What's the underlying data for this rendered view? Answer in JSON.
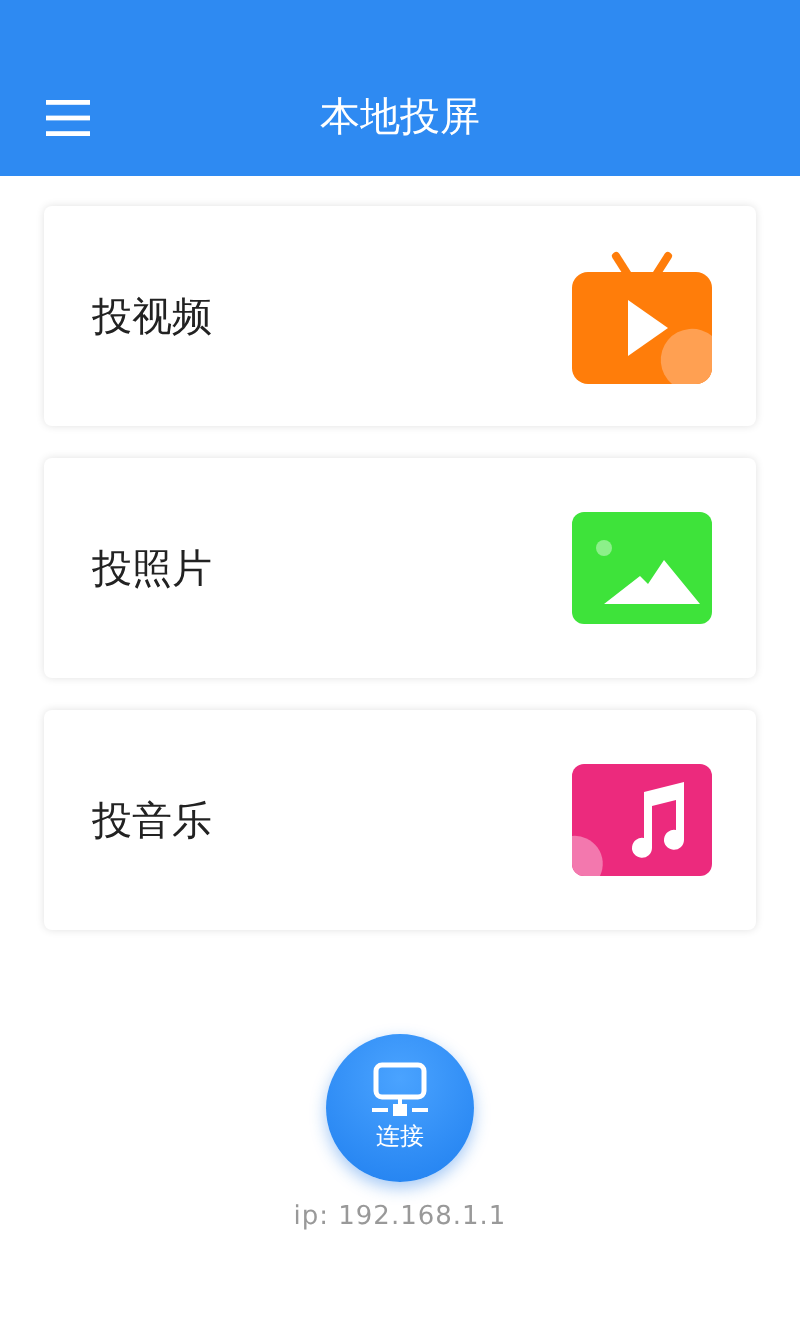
{
  "header": {
    "title": "本地投屏"
  },
  "items": [
    {
      "label": "投视频",
      "kind": "video"
    },
    {
      "label": "投照片",
      "kind": "photo"
    },
    {
      "label": "投音乐",
      "kind": "music"
    }
  ],
  "connect": {
    "label": "连接"
  },
  "ip": "ip: 192.168.1.1"
}
